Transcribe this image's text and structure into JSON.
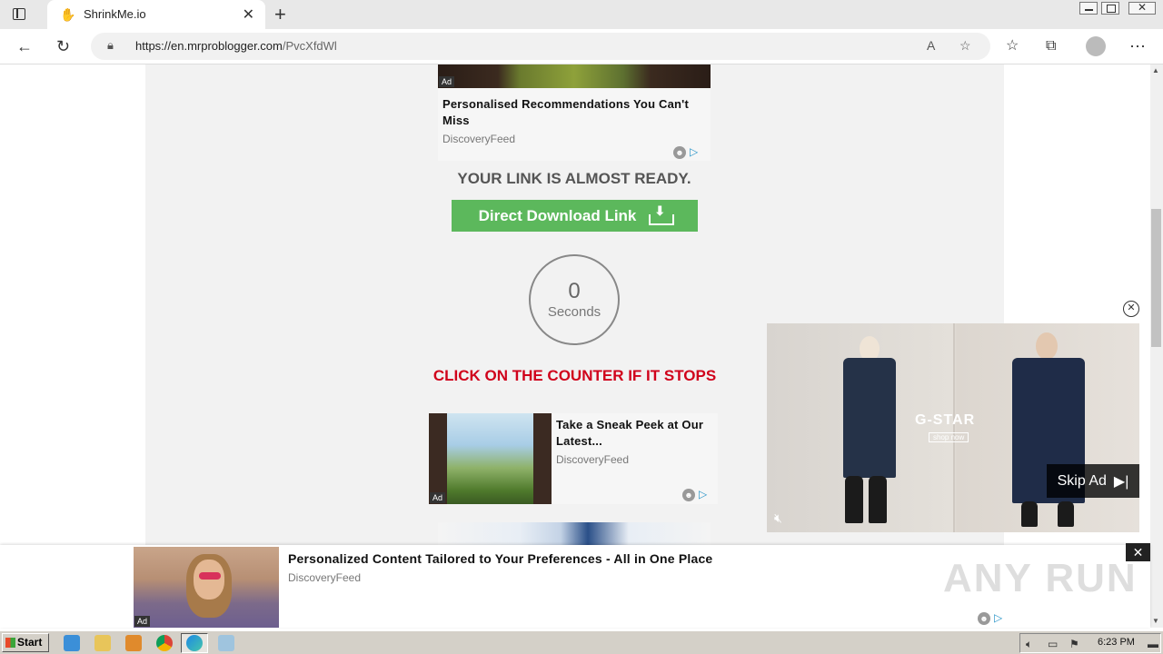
{
  "browser": {
    "tab_title": "ShrinkMe.io",
    "url_host": "https://en.mrproblogger.com",
    "url_path": "/PvcXfdWl"
  },
  "page": {
    "top_ad": {
      "badge": "Ad",
      "title": "Personalised Recommendations You Can't Miss",
      "source": "DiscoveryFeed"
    },
    "ready_heading": "YOUR LINK IS ALMOST READY.",
    "download_button": "Direct Download Link",
    "counter": {
      "value": "0",
      "label": "Seconds"
    },
    "counter_note": "CLICK ON THE COUNTER IF IT STOPS",
    "mid_ad": {
      "badge": "Ad",
      "title": "Take a Sneak Peek at Our Latest...",
      "source": "DiscoveryFeed"
    }
  },
  "video_ad": {
    "brand": "G-STAR",
    "brand_sub": "shop now",
    "skip_label": "Skip Ad"
  },
  "sticky_ad": {
    "badge": "Ad",
    "title": "Personalized Content Tailored to Your Preferences - All in One Place",
    "source": "DiscoveryFeed"
  },
  "watermark": "ANY RUN",
  "taskbar": {
    "start_label": "Start",
    "clock": "6:23 PM"
  },
  "colors": {
    "download_green": "#5cb85c",
    "counter_note_red": "#d0021b",
    "adchoices_blue": "#2a95c8"
  },
  "icons": [
    "tab-actions-icon",
    "favicon-icon",
    "close-icon",
    "plus-icon",
    "back-icon",
    "refresh-icon",
    "lock-icon",
    "read-aloud-icon",
    "add-favorite-icon",
    "favorites-icon",
    "collections-icon",
    "profile-icon",
    "more-icon",
    "download-icon",
    "mute-icon",
    "skip-icon"
  ]
}
